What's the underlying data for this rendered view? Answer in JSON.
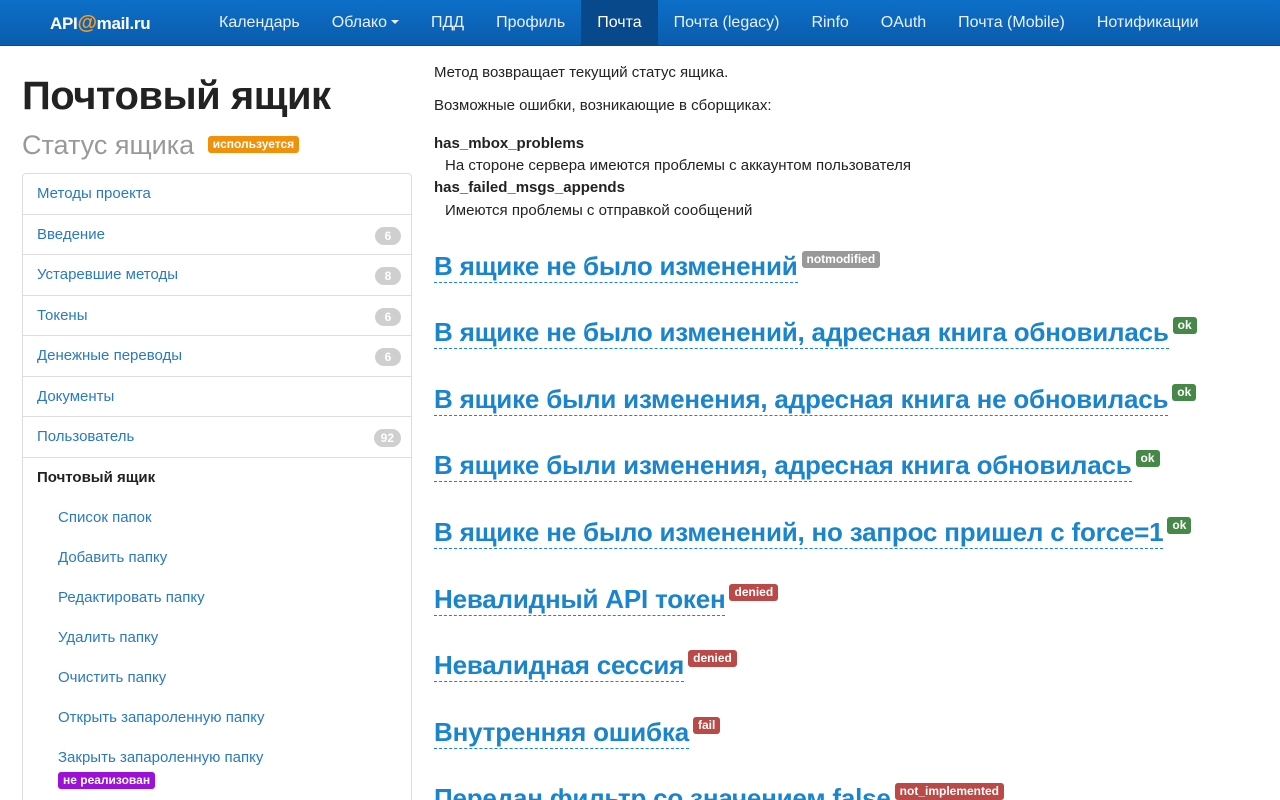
{
  "brand": {
    "text_left": "API",
    "text_at": "@",
    "text_right": "mail.ru"
  },
  "nav": [
    {
      "label": "Календарь"
    },
    {
      "label": "Облако"
    },
    {
      "label": "ПДД"
    },
    {
      "label": "Профиль"
    },
    {
      "label": "Почта"
    },
    {
      "label": "Почта (legacy)"
    },
    {
      "label": "Rinfo"
    },
    {
      "label": "OAuth"
    },
    {
      "label": "Почта (Mobile)"
    },
    {
      "label": "Нотификации"
    }
  ],
  "nav_active": "Почта",
  "sidebar": {
    "title": "Почтовый ящик",
    "subtitle": "Статус ящика",
    "subtitle_label": "используется",
    "items": [
      {
        "label": "Методы проекта",
        "count": ""
      },
      {
        "label": "Введение",
        "count": "6"
      },
      {
        "label": "Устаревшие методы",
        "count": "8"
      },
      {
        "label": "Токены",
        "count": "6"
      },
      {
        "label": "Денежные переводы",
        "count": "6"
      },
      {
        "label": "Документы",
        "count": ""
      },
      {
        "label": "Пользователь",
        "count": "92"
      },
      {
        "label": "Почтовый ящик",
        "count": ""
      }
    ],
    "subitems": [
      {
        "label": "Список папок"
      },
      {
        "label": "Добавить папку"
      },
      {
        "label": "Редактировать папку"
      },
      {
        "label": "Удалить папку"
      },
      {
        "label": "Очистить папку"
      },
      {
        "label": "Открыть запароленную папку"
      },
      {
        "label": "Закрыть запароленную папку",
        "badge": "не реализован"
      }
    ]
  },
  "content": {
    "intro": "Метод возвращает текущий статус ящика.",
    "errors_heading": "Возможные ошибки, возникающие в сборщиках:",
    "errors": [
      {
        "name": "has_mbox_problems",
        "desc": "На стороне сервера имеются проблемы с аккаунтом пользователя"
      },
      {
        "name": "has_failed_msgs_appends",
        "desc": "Имеются проблемы с отправкой сообщений"
      }
    ],
    "statuses": [
      {
        "title": "В ящике не было изменений",
        "label": "notmodified",
        "kind": "default"
      },
      {
        "title": "В ящике не было изменений, адресная книга обновилась",
        "label": "ok",
        "kind": "ok"
      },
      {
        "title": "В ящике были изменения, адресная книга не обновилась",
        "label": "ok",
        "kind": "ok"
      },
      {
        "title": "В ящике были изменения, адресная книга обновилась",
        "label": "ok",
        "kind": "ok"
      },
      {
        "title": "В ящике не было изменений, но запрос пришел с force=1",
        "label": "ok",
        "kind": "ok"
      },
      {
        "title": "Невалидный API токен",
        "label": "denied",
        "kind": "denied"
      },
      {
        "title": "Невалидная сессия",
        "label": "denied",
        "kind": "denied"
      },
      {
        "title": "Внутренняя ошибка",
        "label": "fail",
        "kind": "denied"
      },
      {
        "title": "Передан фильтр со значением false",
        "label": "not_implemented",
        "kind": "denied"
      }
    ]
  },
  "colors": {
    "navbar": "#0b63b8",
    "link": "#1a84cc",
    "label_ok": "#468847",
    "label_denied": "#b94a48",
    "label_warning": "#f0910a",
    "label_purple": "#9b11d6"
  }
}
